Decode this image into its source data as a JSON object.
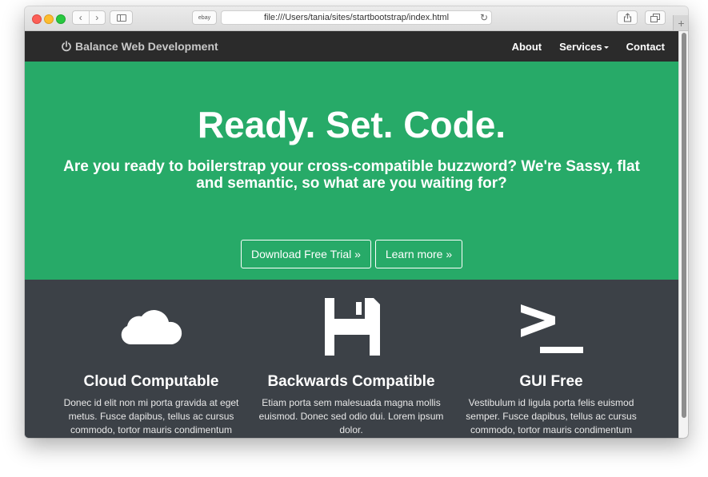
{
  "browser": {
    "address": "file:///Users/tania/sites/startbootstrap/index.html",
    "favorite": "ebay",
    "back_glyph": "‹",
    "forward_glyph": "›",
    "reload_glyph": "↻",
    "newtab_glyph": "+"
  },
  "navbar": {
    "brand": "Balance Web Development",
    "brand_icon": "power-icon",
    "links": [
      "About",
      "Services",
      "Contact"
    ]
  },
  "hero": {
    "title": "Ready. Set. Code.",
    "subtitle": "Are you ready to boilerstrap your cross-compatible buzzword? We're Sassy, flat and semantic, so what are you waiting for?",
    "download_label": "Download Free Trial »",
    "learn_label": "Learn more »",
    "bg_color": "#27aa68"
  },
  "features": [
    {
      "icon": "cloud-icon",
      "title": "Cloud Computable",
      "text": "Donec id elit non mi porta gravida at eget metus. Fusce dapibus, tellus ac cursus commodo, tortor mauris condimentum"
    },
    {
      "icon": "floppy-disk-icon",
      "title": "Backwards Compatible",
      "text": "Etiam porta sem malesuada magna mollis euismod. Donec sed odio dui. Lorem ipsum dolor."
    },
    {
      "icon": "terminal-icon",
      "title": "GUI Free",
      "text": "Vestibulum id ligula porta felis euismod semper. Fusce dapibus, tellus ac cursus commodo, tortor mauris condimentum"
    }
  ],
  "colors": {
    "navbar": "#2b2b2b",
    "features_bg": "#3c4147"
  }
}
